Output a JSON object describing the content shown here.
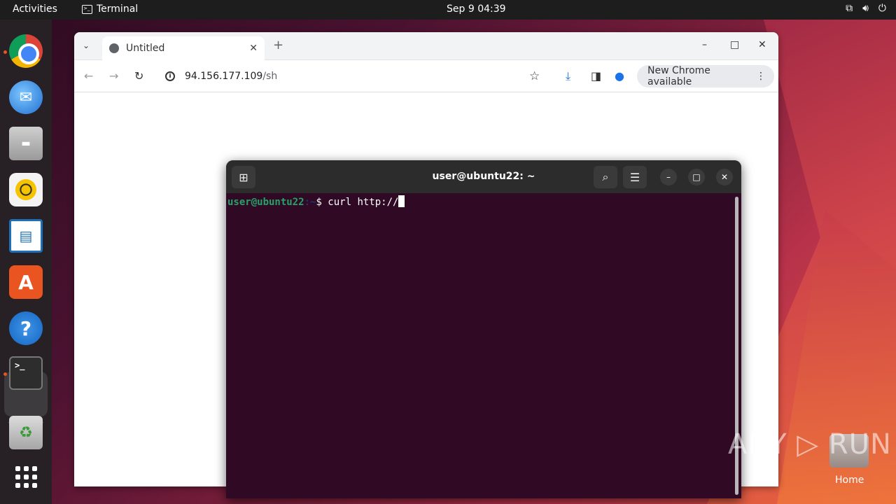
{
  "topbar": {
    "activities": "Activities",
    "app_name": "Terminal",
    "clock": "Sep 9  04:39"
  },
  "browser": {
    "tab_title": "Untitled",
    "url_host": "94.156.177.109",
    "url_path": "/sh",
    "update_label": "New Chrome available"
  },
  "terminal": {
    "title": "user@ubuntu22: ~",
    "prompt_user": "user@ubuntu22",
    "prompt_path": ":~",
    "prompt_symbol": "$ ",
    "command": "curl http://"
  },
  "desktop": {
    "home_label": "Home",
    "watermark": "ANY ▷ RUN"
  },
  "colors": {
    "ubuntu_orange": "#e95420",
    "terminal_bg": "#300a24",
    "prompt_green": "#26a269"
  }
}
